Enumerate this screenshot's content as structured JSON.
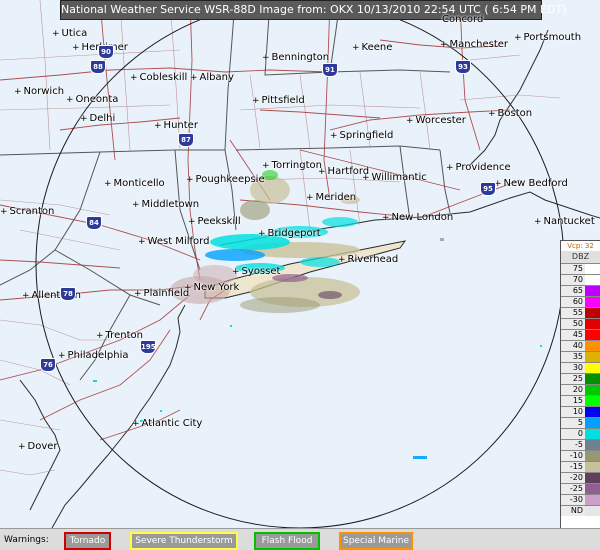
{
  "title": "National Weather Service WSR-88D Image from:  OKX 10/13/2010 22:54 UTC ( 6:54 PM EDT)",
  "cities": [
    {
      "name": "Utica",
      "mark": "+"
    },
    {
      "name": "Herkimer",
      "mark": "+"
    },
    {
      "name": "Norwich",
      "mark": "+"
    },
    {
      "name": "Cobleskill",
      "mark": "+"
    },
    {
      "name": "Albany",
      "mark": "+"
    },
    {
      "name": "Oneonta",
      "mark": "+"
    },
    {
      "name": "Delhi",
      "mark": "+"
    },
    {
      "name": "Hunter",
      "mark": "+"
    },
    {
      "name": "Bennington",
      "mark": "+"
    },
    {
      "name": "Keene",
      "mark": "+"
    },
    {
      "name": "Concord",
      "mark": ""
    },
    {
      "name": "Manchester",
      "mark": "+"
    },
    {
      "name": "Portsmouth",
      "mark": "+"
    },
    {
      "name": "Pittsfield",
      "mark": "+"
    },
    {
      "name": "Springfield",
      "mark": "+"
    },
    {
      "name": "Worcester",
      "mark": "+"
    },
    {
      "name": "Boston",
      "mark": "+"
    },
    {
      "name": "Torrington",
      "mark": "+"
    },
    {
      "name": "Hartford",
      "mark": "+"
    },
    {
      "name": "Willimantic",
      "mark": "+"
    },
    {
      "name": "Providence",
      "mark": "+"
    },
    {
      "name": "New Bedford",
      "mark": "+"
    },
    {
      "name": "Monticello",
      "mark": "+"
    },
    {
      "name": "Poughkeepsie",
      "mark": "+"
    },
    {
      "name": "Scranton",
      "mark": "+"
    },
    {
      "name": "Middletown",
      "mark": "+"
    },
    {
      "name": "Meriden",
      "mark": "+"
    },
    {
      "name": "New London",
      "mark": "+"
    },
    {
      "name": "Nantucket",
      "mark": "+"
    },
    {
      "name": "Peekskill",
      "mark": "+"
    },
    {
      "name": "Bridgeport",
      "mark": "+"
    },
    {
      "name": "West Milford",
      "mark": "+"
    },
    {
      "name": "Riverhead",
      "mark": "+"
    },
    {
      "name": "Syosset",
      "mark": "+"
    },
    {
      "name": "Allentown",
      "mark": "+"
    },
    {
      "name": "Plainfield",
      "mark": "+"
    },
    {
      "name": "New York",
      "mark": "+"
    },
    {
      "name": "Trenton",
      "mark": "+"
    },
    {
      "name": "Philadelphia",
      "mark": "+"
    },
    {
      "name": "Atlantic City",
      "mark": "+"
    },
    {
      "name": "Dover",
      "mark": "+"
    }
  ],
  "highways": [
    "88",
    "90",
    "87",
    "91",
    "93",
    "84",
    "95",
    "78",
    "195",
    "76"
  ],
  "legend": {
    "header": "Vcp: 32",
    "unit": "DBZ",
    "levels": [
      {
        "label": "75",
        "color": "#ffffff"
      },
      {
        "label": "70",
        "color": "#ffffff"
      },
      {
        "label": "65",
        "color": "#c000ff"
      },
      {
        "label": "60",
        "color": "#ff00ff"
      },
      {
        "label": "55",
        "color": "#c00000"
      },
      {
        "label": "50",
        "color": "#e00000"
      },
      {
        "label": "45",
        "color": "#ff0000"
      },
      {
        "label": "40",
        "color": "#ff9000"
      },
      {
        "label": "35",
        "color": "#e0b000"
      },
      {
        "label": "30",
        "color": "#ffff00"
      },
      {
        "label": "25",
        "color": "#009000"
      },
      {
        "label": "20",
        "color": "#00c800"
      },
      {
        "label": "15",
        "color": "#00ff00"
      },
      {
        "label": "10",
        "color": "#0000f0"
      },
      {
        "label": "5",
        "color": "#00a0ff"
      },
      {
        "label": "0",
        "color": "#00e0e0"
      },
      {
        "label": "-5",
        "color": "#708090"
      },
      {
        "label": "-10",
        "color": "#989870"
      },
      {
        "label": "-15",
        "color": "#c8c098"
      },
      {
        "label": "-20",
        "color": "#604060"
      },
      {
        "label": "-25",
        "color": "#906090"
      },
      {
        "label": "-30",
        "color": "#c8a0c8"
      },
      {
        "label": "ND",
        "color": "#e6e6e6"
      }
    ]
  },
  "warnings": {
    "label": "Warnings:",
    "tornado": "Tornado",
    "severe": "Severe Thunderstorm",
    "flash": "Flash Flood",
    "marine": "Special Marine"
  },
  "colors": {
    "tornado": "#d00000",
    "severe": "#ffff40",
    "flash": "#00c000",
    "marine": "#ff9000"
  }
}
